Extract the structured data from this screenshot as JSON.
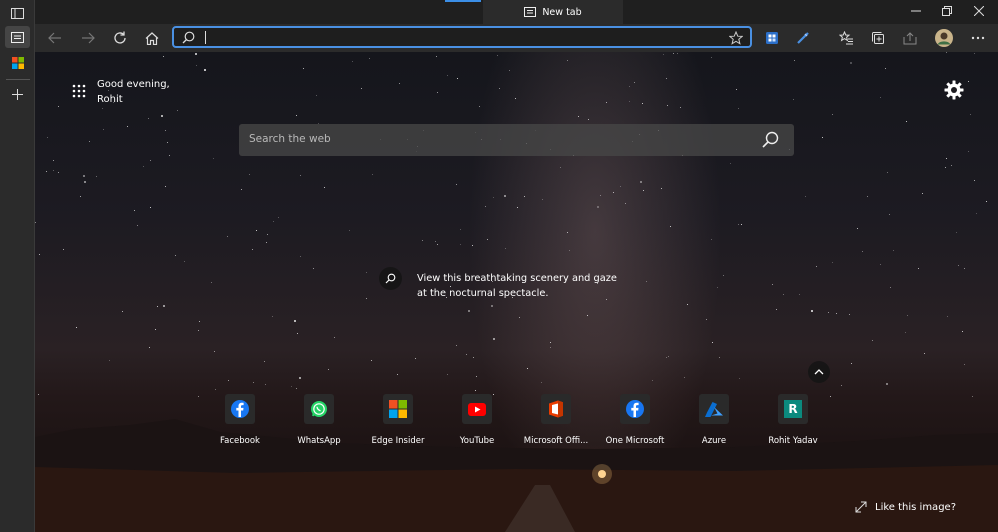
{
  "window": {
    "tab_title": "New tab"
  },
  "addressbar": {
    "value": "",
    "placeholder": ""
  },
  "greeting": {
    "line1": "Good evening,",
    "line2": "Rohit"
  },
  "search": {
    "placeholder": "Search the web"
  },
  "image_info": {
    "line1": "View this breathtaking scenery and gaze",
    "line2": "at the nocturnal spectacle."
  },
  "quick_links": [
    {
      "label": "Facebook",
      "icon": "facebook-icon"
    },
    {
      "label": "WhatsApp",
      "icon": "whatsapp-icon"
    },
    {
      "label": "Edge Insider",
      "icon": "microsoft-logo-icon"
    },
    {
      "label": "YouTube",
      "icon": "youtube-icon"
    },
    {
      "label": "Microsoft Offi...",
      "icon": "office-icon"
    },
    {
      "label": "One Microsoft",
      "icon": "facebook-icon"
    },
    {
      "label": "Azure",
      "icon": "azure-icon"
    },
    {
      "label": "Rohit Yadav",
      "icon": "letter-r-icon",
      "letter": "R"
    }
  ],
  "footer": {
    "like_label": "Like this image?"
  },
  "colors": {
    "accent": "#4a90e2",
    "toolbar": "#2b2b2b",
    "titlebar": "#1f1f1f"
  }
}
